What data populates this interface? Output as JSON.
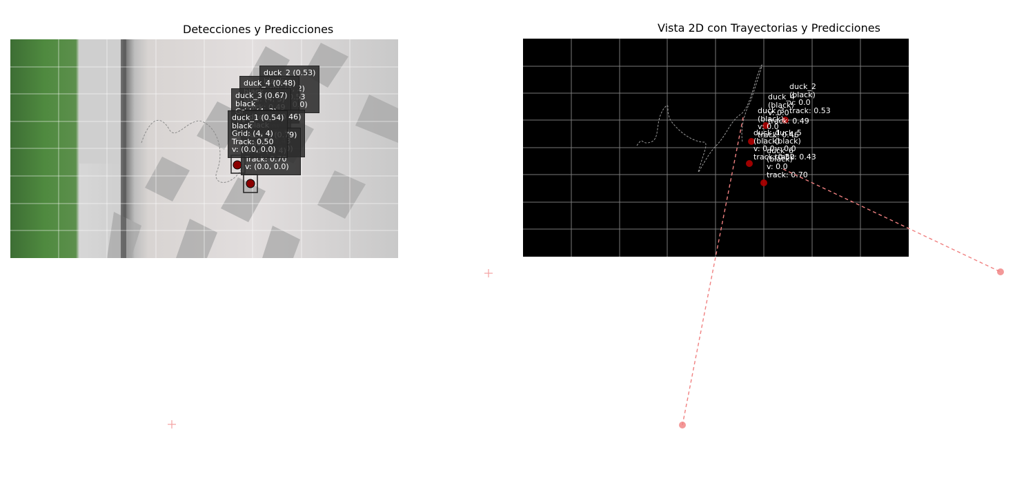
{
  "left": {
    "title": "Detecciones y Predicciones",
    "labels": [
      {
        "text": "duck_2 (0.53)\nblack\nGrid: (4, 2)\nTrack: 0.53\nv: (0.0, 0.0)"
      },
      {
        "text": "duck_4 (0.48)\nblack\nGrid: (4, 3)\nTrack: 0.49\nv: (0.0, 0.0)"
      },
      {
        "text": "duck_3 (0.67)\nblack\nGrid: (4, 3)\nTrack: 0.46\nv: (0.0, 0.0)"
      },
      {
        "text": "duck_5 (0.46)\nblack\nGrid: (4, 4)\nTrack: 0.43\nv: (0.0, 0.0)"
      },
      {
        "text": "duck_6 (0.79)\nblack\nGrid: (4, 4)\nTrack: 0.70\nv: (0.0, 0.0)"
      },
      {
        "text": "duck_1 (0.54)\nblack\nGrid: (4, 4)\nTrack: 0.50\nv: (0.0, 0.0)"
      }
    ],
    "colors": {
      "prediction": "#f4a0a0",
      "detection_dot": "#8b0000"
    }
  },
  "right": {
    "title": "Vista 2D con Trayectorias y Predicciones",
    "labels": [
      {
        "text": "duck_2\n(black)\nv: 0.0\ntrack: 0.53"
      },
      {
        "text": "duck_4\n(black)\nv: 0.0\ntrack: 0.49"
      },
      {
        "text": "duck_3\n(black)\nv: 0.0\ntrack: 0.46"
      },
      {
        "text": "duck_1\n(black)\nv: 0.0\ntrack: 0.50"
      },
      {
        "text": "duck_5\n(black)\nv: 0.0\ntrack: 0.43"
      },
      {
        "text": "duck_6\n(black)\nv: 0.0\ntrack: 0.70"
      }
    ],
    "colors": {
      "background": "#000000",
      "grid": "#7a7a7a",
      "trajectory": "#9a9a9a",
      "prediction": "#f08080",
      "detection_dot": "#b00000"
    }
  }
}
